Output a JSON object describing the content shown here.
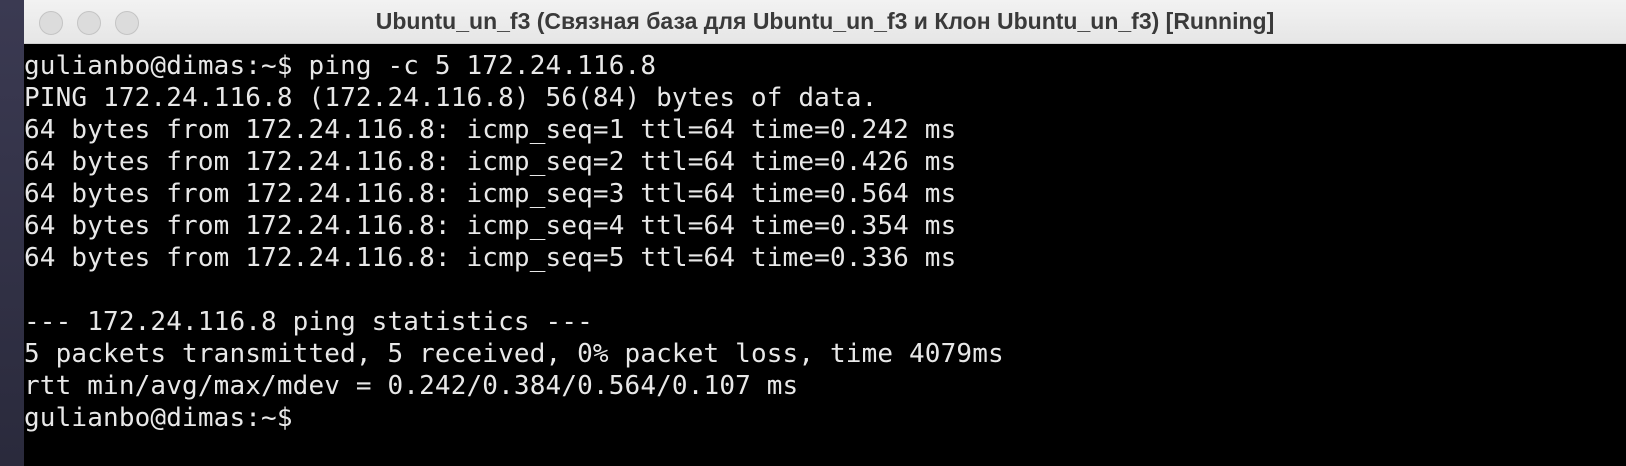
{
  "window": {
    "title": "Ubuntu_un_f3 (Связная база для Ubuntu_un_f3 и Клон Ubuntu_un_f3) [Running]"
  },
  "terminal": {
    "lines": [
      "gulianbo@dimas:~$ ping -c 5 172.24.116.8",
      "PING 172.24.116.8 (172.24.116.8) 56(84) bytes of data.",
      "64 bytes from 172.24.116.8: icmp_seq=1 ttl=64 time=0.242 ms",
      "64 bytes from 172.24.116.8: icmp_seq=2 ttl=64 time=0.426 ms",
      "64 bytes from 172.24.116.8: icmp_seq=3 ttl=64 time=0.564 ms",
      "64 bytes from 172.24.116.8: icmp_seq=4 ttl=64 time=0.354 ms",
      "64 bytes from 172.24.116.8: icmp_seq=5 ttl=64 time=0.336 ms",
      "",
      "--- 172.24.116.8 ping statistics ---",
      "5 packets transmitted, 5 received, 0% packet loss, time 4079ms",
      "rtt min/avg/max/mdev = 0.242/0.384/0.564/0.107 ms",
      "gulianbo@dimas:~$"
    ]
  },
  "colors": {
    "terminal_bg": "#000000",
    "terminal_fg": "#e8e8e8",
    "titlebar_bg": "#ececec",
    "title_text": "#3a3a3a",
    "traffic_light": "#dcdcdc"
  }
}
